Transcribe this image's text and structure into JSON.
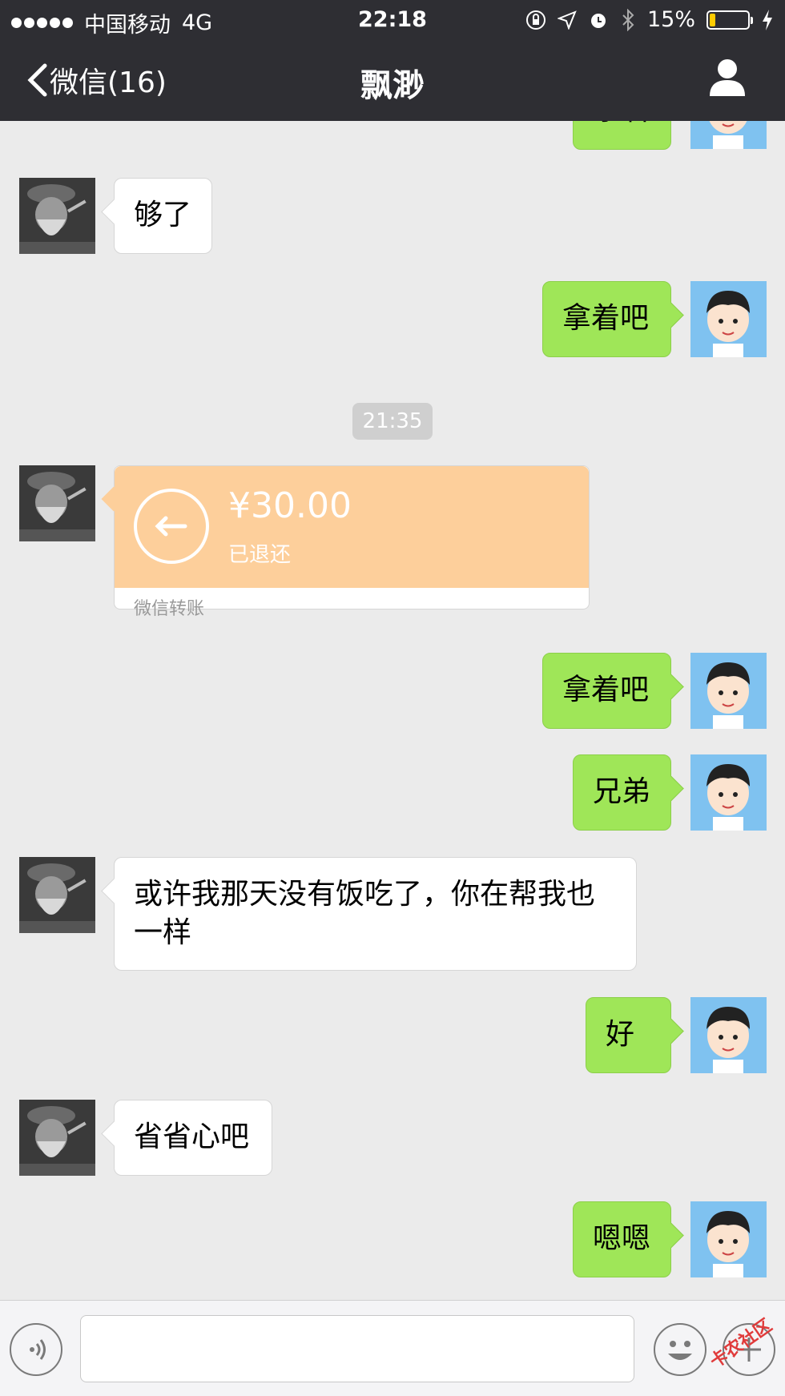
{
  "status_bar": {
    "carrier": "中国移动",
    "network": "4G",
    "time": "22:18",
    "battery": "15%",
    "battery_level": 0.15
  },
  "nav": {
    "back_label": "微信(16)",
    "title": "飘渺"
  },
  "messages": [
    {
      "side": "out",
      "text": "拿着"
    },
    {
      "side": "in",
      "text": "够了"
    },
    {
      "side": "out",
      "text": "拿着吧"
    },
    {
      "type": "time",
      "text": "21:35"
    },
    {
      "side": "in",
      "type": "transfer",
      "amount": "¥30.00",
      "status": "已退还",
      "footer": "微信转账"
    },
    {
      "side": "out",
      "text": "拿着吧"
    },
    {
      "side": "out",
      "text": "兄弟"
    },
    {
      "side": "in",
      "text": "或许我那天没有饭吃了，你在帮我也一样"
    },
    {
      "side": "out",
      "text": "好"
    },
    {
      "side": "in",
      "text": "省省心吧"
    },
    {
      "side": "out",
      "text": "嗯嗯"
    }
  ],
  "input": {
    "value": "",
    "placeholder": ""
  },
  "watermark": "卡农社区",
  "colors": {
    "nav_bg": "#2e2e33",
    "chat_bg": "#ebebeb",
    "out_bubble": "#9fe658",
    "in_bubble": "#ffffff",
    "transfer": "#fdcf9b"
  }
}
